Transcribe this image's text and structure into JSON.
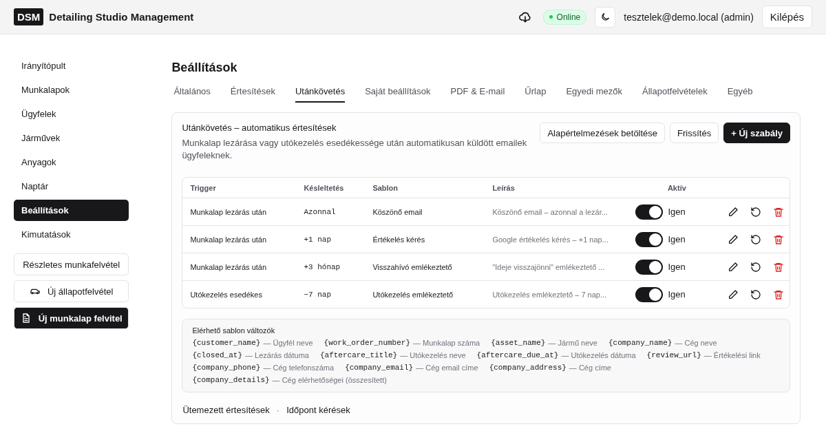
{
  "header": {
    "logo": "DSM",
    "title": "Detailing Studio Management",
    "status": "Online",
    "online": true,
    "user": "tesztelek@demo.local (admin)",
    "logout": "Kilépés"
  },
  "sidebar": {
    "items": [
      {
        "label": "Irányítópult",
        "selected": false
      },
      {
        "label": "Munkalapok",
        "selected": false
      },
      {
        "label": "Ügyfelek",
        "selected": false
      },
      {
        "label": "Járművek",
        "selected": false
      },
      {
        "label": "Anyagok",
        "selected": false
      },
      {
        "label": "Naptár",
        "selected": false
      },
      {
        "label": "Beállítások",
        "selected": true
      },
      {
        "label": "Kimutatások",
        "selected": false
      }
    ],
    "buttons": [
      {
        "label": "Részletes munkafelvétel",
        "kind": "plain"
      },
      {
        "label": "Új állapotfelvétel",
        "kind": "car"
      },
      {
        "label": "Új munkalap felvitel",
        "kind": "document"
      }
    ]
  },
  "page": {
    "title": "Beállítások"
  },
  "tabs": [
    {
      "label": "Általános",
      "selected": false
    },
    {
      "label": "Értesítések",
      "selected": false
    },
    {
      "label": "Utánkövetés",
      "selected": true
    },
    {
      "label": "Saját beállítások",
      "selected": false
    },
    {
      "label": "PDF & E-mail",
      "selected": false
    },
    {
      "label": "Űrlap",
      "selected": false
    },
    {
      "label": "Egyedi mezők",
      "selected": false
    },
    {
      "label": "Állapotfelvételek",
      "selected": false
    },
    {
      "label": "Egyéb",
      "selected": false
    }
  ],
  "card": {
    "title": "Utánkövetés – automatikus értesítések",
    "description": "Munkalap lezárása vagy utókezelés esedékessége után automatikusan küldött emailek ügyfeleknek.",
    "buttons": [
      {
        "label": "Alapértelmezések betöltése",
        "primary": false
      },
      {
        "label": "Frissítés",
        "primary": false
      },
      {
        "label": "+ Új szabály",
        "primary": true
      }
    ]
  },
  "table": {
    "columns": [
      "Trigger",
      "Késleltetés",
      "Sablon",
      "Leírás",
      "Aktív"
    ],
    "rows": [
      {
        "trigger": "Munkalap lezárás után",
        "delay": "Azonnal",
        "template": "Köszönő email",
        "description": "Köszönő email – azonnal a lezár...",
        "on": true,
        "active_label": "Igen"
      },
      {
        "trigger": "Munkalap lezárás után",
        "delay": "+1 nap",
        "template": "Értékelés kérés",
        "description": "Google értékelés kérés – +1 nap...",
        "on": true,
        "active_label": "Igen"
      },
      {
        "trigger": "Munkalap lezárás után",
        "delay": "+3 hónap",
        "template": "Visszahívó emlékeztető",
        "description": "\"Ideje visszajönni\" emlékeztető ...",
        "on": true,
        "active_label": "Igen"
      },
      {
        "trigger": "Utókezelés esedékes",
        "delay": "−7 nap",
        "template": "Utókezelés emlékeztető",
        "description": "Utókezelés emlékeztető – 7 nap...",
        "on": true,
        "active_label": "Igen"
      }
    ]
  },
  "variables": {
    "title": "Elérhető sablon változók",
    "lines": [
      [
        {
          "code": "{customer_name}",
          "desc": "— Ügyfél neve"
        },
        {
          "code": "{work_order_number}",
          "desc": "— Munkalap száma"
        },
        {
          "code": "{asset_name}",
          "desc": "— Jármű neve"
        },
        {
          "code": "{company_name}",
          "desc": "— Cég neve"
        }
      ],
      [
        {
          "code": "{closed_at}",
          "desc": "— Lezárás dátuma"
        },
        {
          "code": "{aftercare_title}",
          "desc": "— Utókezelés neve"
        },
        {
          "code": "{aftercare_due_at}",
          "desc": "— Utókezelés dátuma"
        },
        {
          "code": "{review_url}",
          "desc": "— Értékelési link"
        }
      ],
      [
        {
          "code": "{company_phone}",
          "desc": "— Cég telefonszáma"
        },
        {
          "code": "{company_email}",
          "desc": "— Cég email címe"
        },
        {
          "code": "{company_address}",
          "desc": "— Cég címe"
        }
      ],
      [
        {
          "code": "{company_details}",
          "desc": "— Cég elérhetőségei (összesített)"
        }
      ]
    ]
  },
  "footer_links": {
    "items": [
      "Ütemezett értesítések",
      "Időpont kérések"
    ],
    "separator": "·"
  }
}
